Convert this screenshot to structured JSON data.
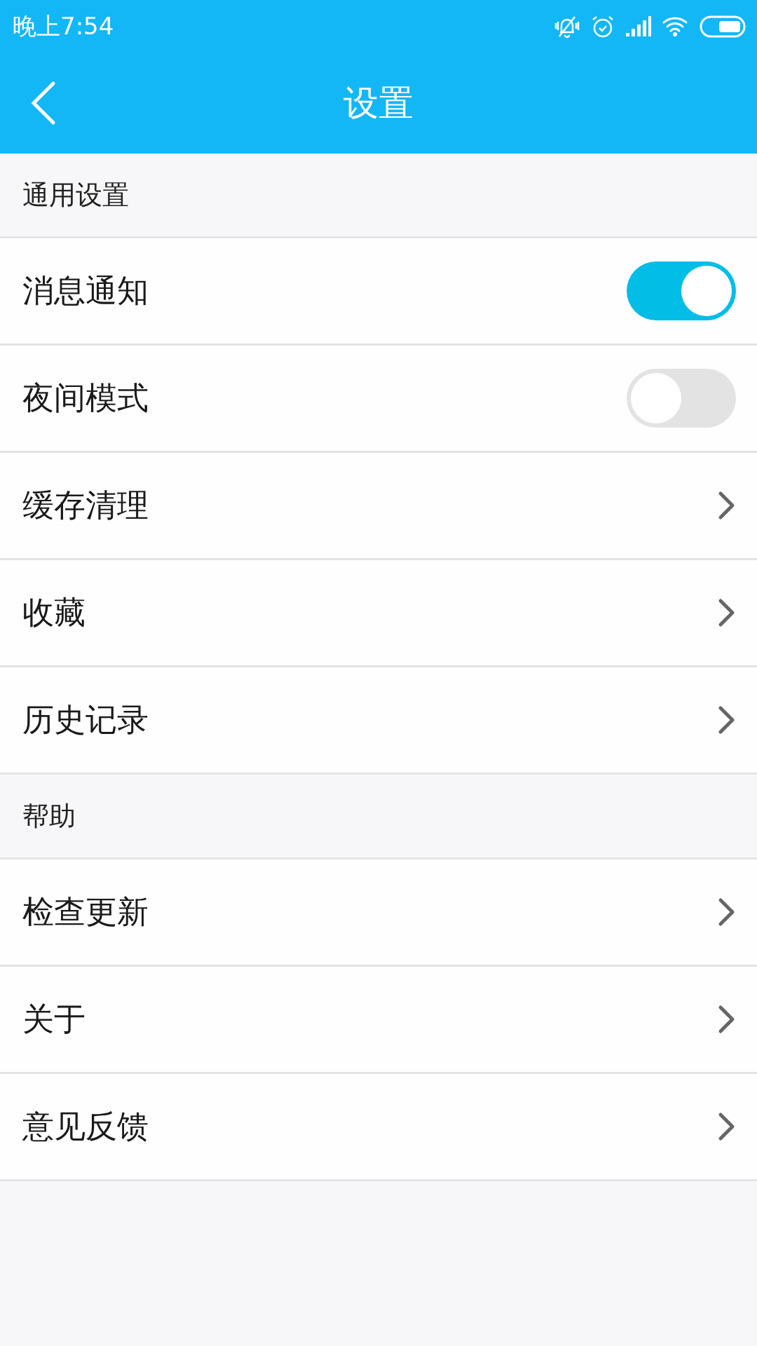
{
  "status_bar": {
    "time": "晚上7:54"
  },
  "toolbar": {
    "title": "设置"
  },
  "sections": [
    {
      "title": "通用设置",
      "items": [
        {
          "kind": "toggle",
          "label": "消息通知",
          "on": true
        },
        {
          "kind": "toggle",
          "label": "夜间模式",
          "on": false
        },
        {
          "kind": "link",
          "label": "缓存清理"
        },
        {
          "kind": "link",
          "label": "收藏"
        },
        {
          "kind": "link",
          "label": "历史记录"
        }
      ]
    },
    {
      "title": "帮助",
      "items": [
        {
          "kind": "link",
          "label": "检查更新"
        },
        {
          "kind": "link",
          "label": "关于"
        },
        {
          "kind": "link",
          "label": "意见反馈"
        }
      ]
    }
  ]
}
